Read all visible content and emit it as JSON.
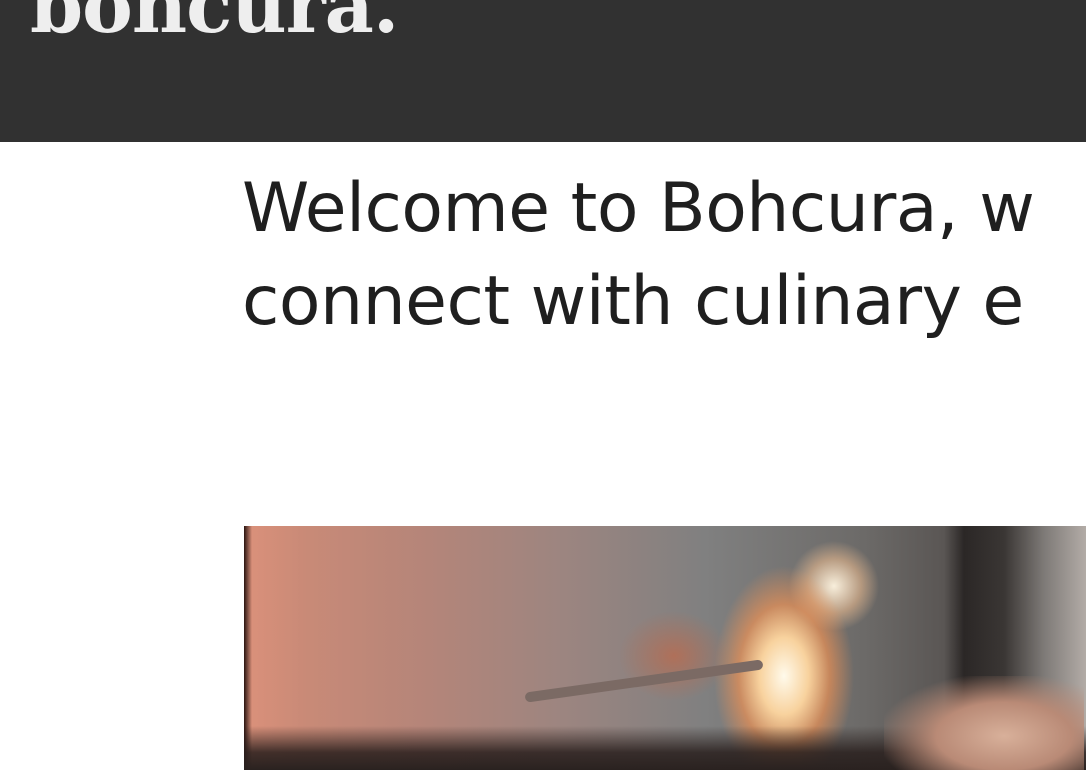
{
  "header": {
    "logo_text": "bohcura."
  },
  "main": {
    "headline_line1": "Welcome to Bohcura, w",
    "headline_line2": "connect with culinary e",
    "hero_image": "kitchen-flambe-photo"
  },
  "colors": {
    "header_bg": "#313131",
    "logo": "#eeeeee",
    "headline": "#1f1f1f",
    "page_bg": "#ffffff"
  }
}
